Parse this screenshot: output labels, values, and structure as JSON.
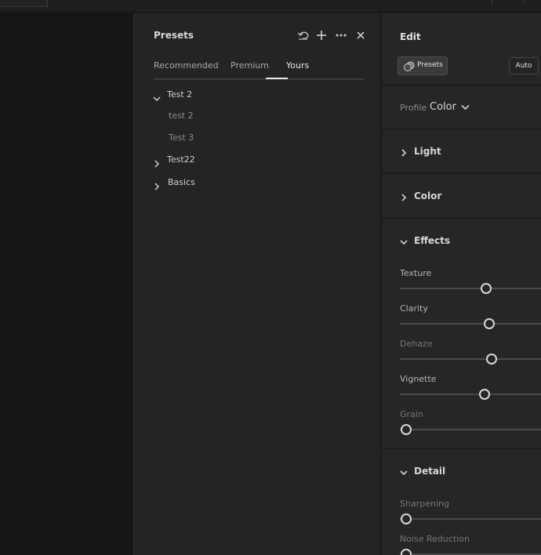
{
  "presets_panel": {
    "title": "Presets",
    "icons": [
      "undo-icon",
      "plus-icon",
      "more-icon",
      "close-icon"
    ],
    "tabs": [
      {
        "label": "Recommended",
        "active": false
      },
      {
        "label": "Premium",
        "active": false
      },
      {
        "label": "Yours",
        "active": true
      }
    ],
    "tree": [
      {
        "label": "Test 2",
        "expanded": true,
        "children": [
          "test 2",
          "Test 3"
        ]
      },
      {
        "label": "Test22",
        "expanded": false
      },
      {
        "label": "Basics",
        "expanded": false
      }
    ]
  },
  "edit_panel": {
    "title": "Edit",
    "presets_button": "Presets",
    "auto_button": "Auto",
    "profile_label": "Profile",
    "profile_value": "Color",
    "sections": {
      "light": "Light",
      "color": "Color",
      "effects": "Effects",
      "detail": "Detail"
    },
    "effects_sliders": [
      {
        "label": "Texture",
        "value_fraction": 0.59
      },
      {
        "label": "Clarity",
        "value_fraction": 0.61
      },
      {
        "label": "Dehaze",
        "value_fraction": 0.63
      },
      {
        "label": "Vignette",
        "value_fraction": 0.58
      },
      {
        "label": "Grain",
        "value_fraction": 0.0
      }
    ],
    "detail_sliders": [
      {
        "label": "Sharpening",
        "value_fraction": 0.0
      },
      {
        "label": "Noise Reduction",
        "value_fraction": 0.0
      }
    ]
  },
  "colors": {
    "background": "#1a1a1a",
    "panel": "#242424",
    "accent_text": "#e8e8e8"
  }
}
